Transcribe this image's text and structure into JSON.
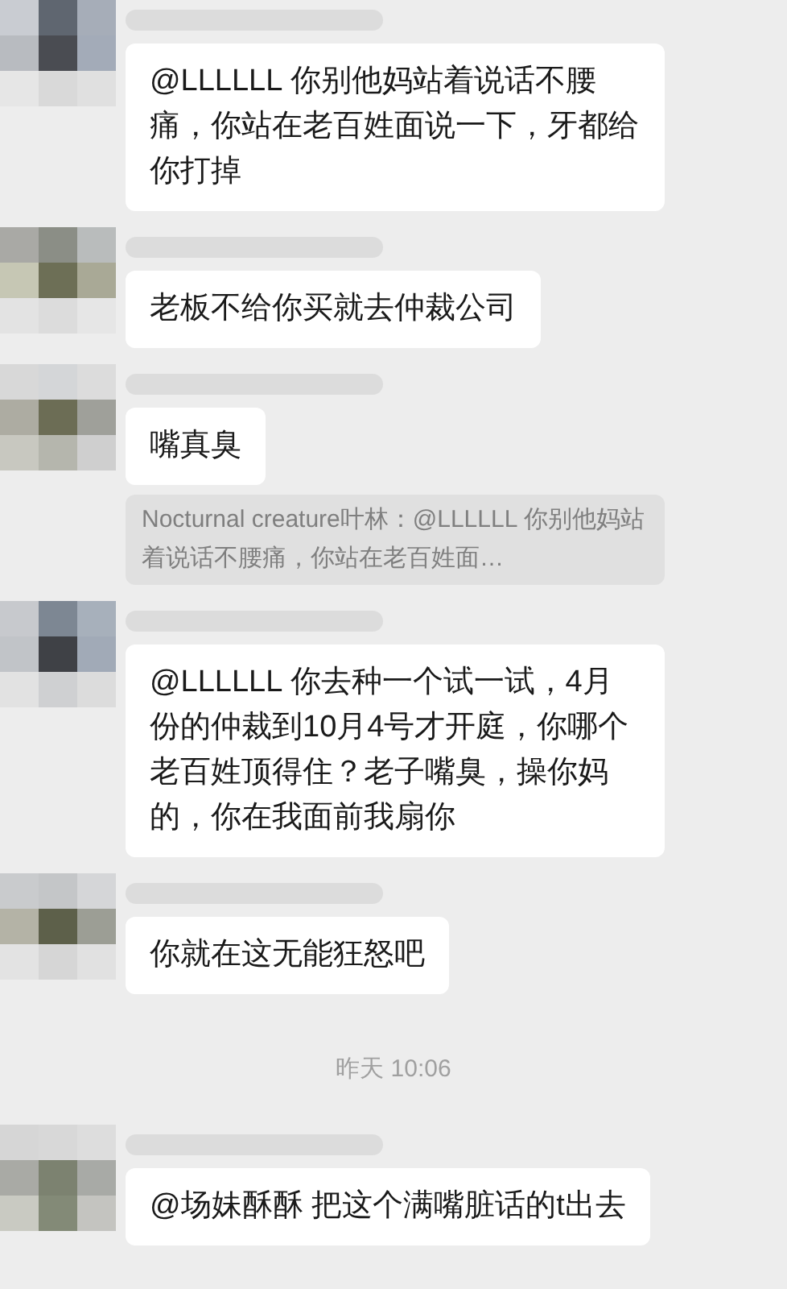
{
  "items": [
    {
      "kind": "message",
      "text": "@LLLLLL  你别他妈站着说话不腰痛，你站在老百姓面说一下，牙都给你打掉"
    },
    {
      "kind": "message",
      "text": "老板不给你买就去仲裁公司"
    },
    {
      "kind": "message",
      "text": "嘴真臭"
    },
    {
      "kind": "quote",
      "text": "Nocturnal creature叶林：@LLLLLL 你别他妈站着说话不腰痛，你站在老百姓面…"
    },
    {
      "kind": "message",
      "text": "@LLLLLL  你去种一个试一试，4月份的仲裁到10月4号才开庭，你哪个老百姓顶得住？老子嘴臭，操你妈的，你在我面前我扇你"
    },
    {
      "kind": "message",
      "text": "你就在这无能狂怒吧"
    },
    {
      "kind": "time",
      "text": "昨天 10:06"
    },
    {
      "kind": "message",
      "text": "@场妹酥酥  把这个满嘴脏话的t出去"
    }
  ]
}
